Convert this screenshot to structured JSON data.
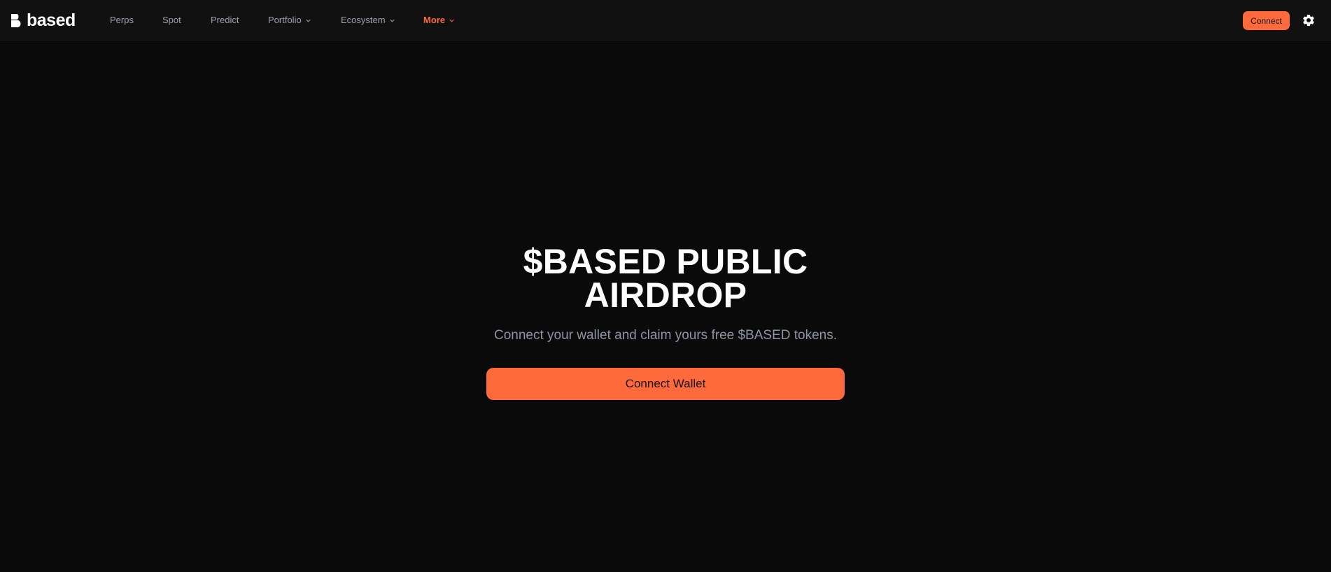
{
  "brand": {
    "name": "based",
    "accent_color": "#ff6a3d",
    "logo_icon": "based-logo-icon"
  },
  "nav": {
    "items": [
      {
        "label": "Perps",
        "has_dropdown": false
      },
      {
        "label": "Spot",
        "has_dropdown": false
      },
      {
        "label": "Predict",
        "has_dropdown": false
      },
      {
        "label": "Portfolio",
        "has_dropdown": true
      },
      {
        "label": "Ecosystem",
        "has_dropdown": true
      },
      {
        "label": "More",
        "has_dropdown": true,
        "active": true
      }
    ],
    "connect_label": "Connect",
    "settings_icon": "gear-icon"
  },
  "hero": {
    "title_line1": "$BASED PUBLIC",
    "title_line2": "AIRDROP",
    "subtitle": "Connect your wallet and claim yours free $BASED tokens.",
    "cta_label": "Connect Wallet"
  }
}
